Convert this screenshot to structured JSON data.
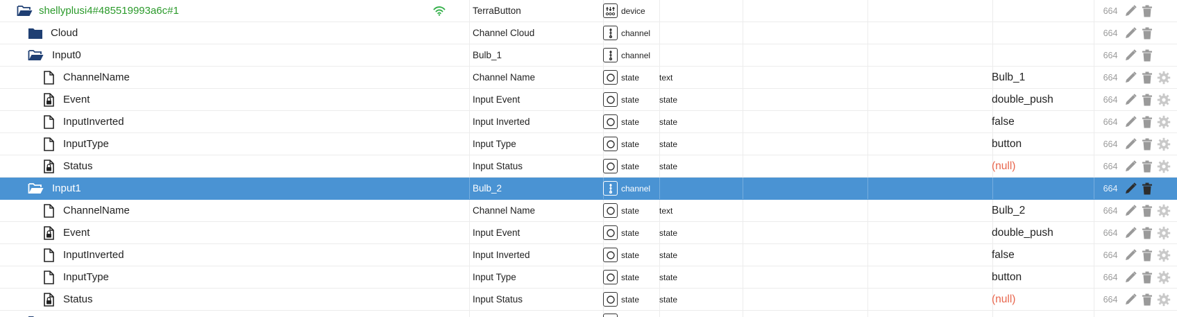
{
  "colors": {
    "selected_bg": "#4a93d3",
    "device_name": "#2b9a2b",
    "null_value": "#e8664d",
    "folder_icon": "#1f3f73",
    "wifi_icon": "#34b04a"
  },
  "rows": [
    {
      "level": 0,
      "kind": "folder-open",
      "name": "shellyplusi4#485519993a6c#1",
      "wifi": true,
      "title": "TerraButton",
      "role_icon": "device-icon",
      "role": "device",
      "type": "",
      "value": "",
      "num": "664",
      "gear": false,
      "selected": false
    },
    {
      "level": 1,
      "kind": "folder",
      "name": "Cloud",
      "title": "Channel Cloud",
      "role_icon": "channel-icon",
      "role": "channel",
      "type": "",
      "value": "",
      "num": "664",
      "gear": false,
      "selected": false
    },
    {
      "level": 1,
      "kind": "folder-open",
      "name": "Input0",
      "title": "Bulb_1",
      "role_icon": "channel-icon",
      "role": "channel",
      "type": "",
      "value": "",
      "num": "664",
      "gear": false,
      "selected": false
    },
    {
      "level": 2,
      "kind": "file",
      "name": "ChannelName",
      "title": "Channel Name",
      "role_icon": "state-icon",
      "role": "state",
      "type": "text",
      "value": "Bulb_1",
      "num": "664",
      "gear": true,
      "selected": false
    },
    {
      "level": 2,
      "kind": "file-lock",
      "name": "Event",
      "title": "Input Event",
      "role_icon": "state-icon",
      "role": "state",
      "type": "state",
      "value": "double_push",
      "num": "664",
      "gear": true,
      "selected": false
    },
    {
      "level": 2,
      "kind": "file",
      "name": "InputInverted",
      "title": "Input Inverted",
      "role_icon": "state-icon",
      "role": "state",
      "type": "state",
      "value": "false",
      "num": "664",
      "gear": true,
      "selected": false
    },
    {
      "level": 2,
      "kind": "file",
      "name": "InputType",
      "title": "Input Type",
      "role_icon": "state-icon",
      "role": "state",
      "type": "state",
      "value": "button",
      "num": "664",
      "gear": true,
      "selected": false
    },
    {
      "level": 2,
      "kind": "file-lock",
      "name": "Status",
      "title": "Input Status",
      "role_icon": "state-icon",
      "role": "state",
      "type": "state",
      "value": "(null)",
      "null": true,
      "num": "664",
      "gear": true,
      "selected": false
    },
    {
      "level": 1,
      "kind": "folder-open",
      "name": "Input1",
      "title": "Bulb_2",
      "role_icon": "channel-icon",
      "role": "channel",
      "type": "",
      "value": "",
      "num": "664",
      "gear": false,
      "selected": true
    },
    {
      "level": 2,
      "kind": "file",
      "name": "ChannelName",
      "title": "Channel Name",
      "role_icon": "state-icon",
      "role": "state",
      "type": "text",
      "value": "Bulb_2",
      "num": "664",
      "gear": true,
      "selected": false
    },
    {
      "level": 2,
      "kind": "file-lock",
      "name": "Event",
      "title": "Input Event",
      "role_icon": "state-icon",
      "role": "state",
      "type": "state",
      "value": "double_push",
      "num": "664",
      "gear": true,
      "selected": false
    },
    {
      "level": 2,
      "kind": "file",
      "name": "InputInverted",
      "title": "Input Inverted",
      "role_icon": "state-icon",
      "role": "state",
      "type": "state",
      "value": "false",
      "num": "664",
      "gear": true,
      "selected": false
    },
    {
      "level": 2,
      "kind": "file",
      "name": "InputType",
      "title": "Input Type",
      "role_icon": "state-icon",
      "role": "state",
      "type": "state",
      "value": "button",
      "num": "664",
      "gear": true,
      "selected": false
    },
    {
      "level": 2,
      "kind": "file-lock",
      "name": "Status",
      "title": "Input Status",
      "role_icon": "state-icon",
      "role": "state",
      "type": "state",
      "value": "(null)",
      "null": true,
      "num": "664",
      "gear": true,
      "selected": false
    }
  ]
}
